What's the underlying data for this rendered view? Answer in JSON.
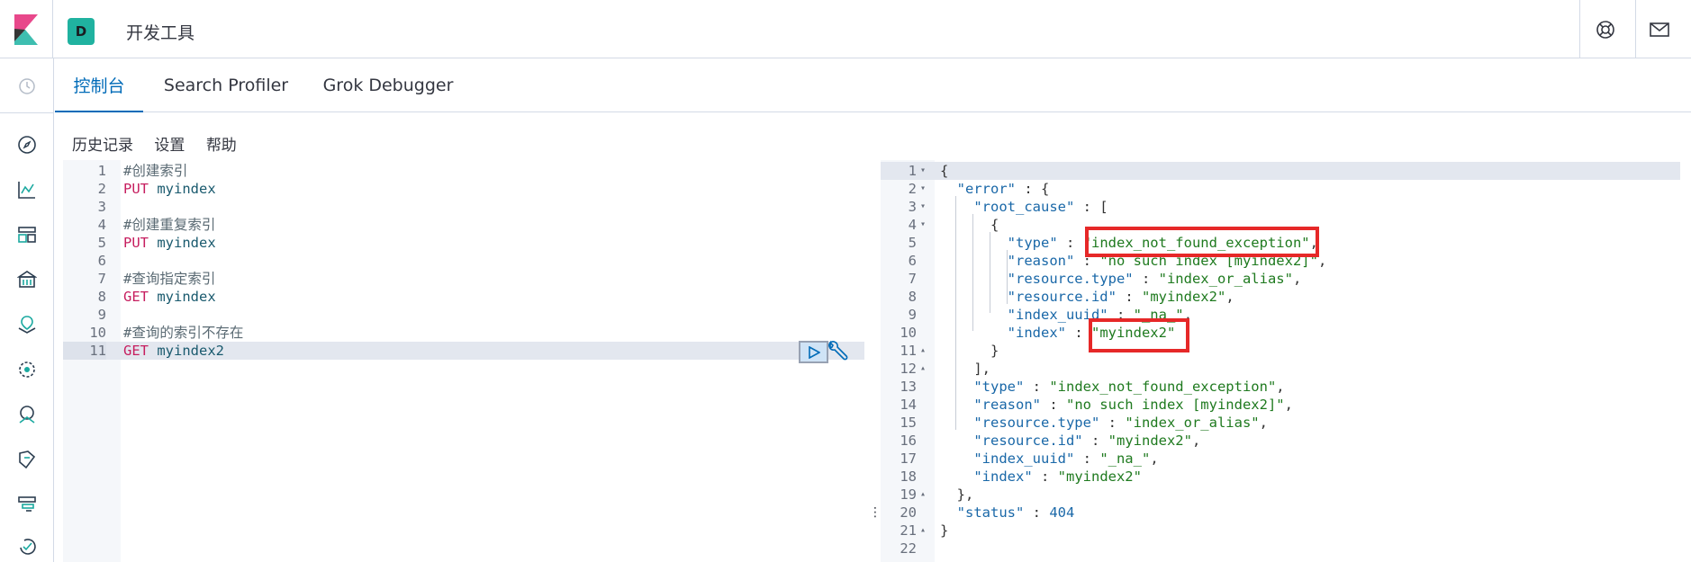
{
  "header": {
    "space_initial": "D",
    "title": "开发工具",
    "icons": [
      "help-lifebuoy-icon",
      "mail-icon"
    ]
  },
  "nav": {
    "icons": [
      "recent-clock-icon",
      "discover-compass-icon",
      "visualize-chart-icon",
      "dashboard-icon",
      "canvas-icon",
      "maps-icon",
      "ml-icon",
      "infrastructure-icon",
      "logs-icon",
      "apm-icon",
      "uptime-icon"
    ]
  },
  "tabs": [
    {
      "label": "控制台",
      "active": true
    },
    {
      "label": "Search Profiler",
      "active": false
    },
    {
      "label": "Grok Debugger",
      "active": false
    }
  ],
  "menu": {
    "history": "历史记录",
    "settings": "设置",
    "help": "帮助"
  },
  "request": {
    "lines": [
      {
        "n": "1",
        "type": "comment",
        "text": "#创建索引"
      },
      {
        "n": "2",
        "type": "req",
        "method": "PUT",
        "url": "myindex"
      },
      {
        "n": "3",
        "type": "blank",
        "text": ""
      },
      {
        "n": "4",
        "type": "comment",
        "text": "#创建重复索引"
      },
      {
        "n": "5",
        "type": "req",
        "method": "PUT",
        "url": "myindex"
      },
      {
        "n": "6",
        "type": "blank",
        "text": ""
      },
      {
        "n": "7",
        "type": "comment",
        "text": "#查询指定索引"
      },
      {
        "n": "8",
        "type": "req",
        "method": "GET",
        "url": "myindex"
      },
      {
        "n": "9",
        "type": "blank",
        "text": ""
      },
      {
        "n": "10",
        "type": "comment",
        "text": "#查询的索引不存在"
      },
      {
        "n": "11",
        "type": "req",
        "method": "GET",
        "url": "myindex2",
        "active": true
      }
    ]
  },
  "response": {
    "lines": [
      {
        "n": "1",
        "fold": "▾",
        "tokens": [
          [
            "pun",
            "{"
          ]
        ]
      },
      {
        "n": "2",
        "fold": "▾",
        "tokens": [
          [
            "pun",
            "  "
          ],
          [
            "key",
            "\"error\""
          ],
          [
            "pun",
            " : {"
          ]
        ]
      },
      {
        "n": "3",
        "fold": "▾",
        "tokens": [
          [
            "pun",
            "    "
          ],
          [
            "key",
            "\"root_cause\""
          ],
          [
            "pun",
            " : ["
          ]
        ]
      },
      {
        "n": "4",
        "fold": "▾",
        "tokens": [
          [
            "pun",
            "      {"
          ]
        ]
      },
      {
        "n": "5",
        "fold": "",
        "tokens": [
          [
            "pun",
            "        "
          ],
          [
            "key",
            "\"type\""
          ],
          [
            "pun",
            " : "
          ],
          [
            "str",
            "\"index_not_found_exception\""
          ],
          [
            "pun",
            ","
          ]
        ]
      },
      {
        "n": "6",
        "fold": "",
        "tokens": [
          [
            "pun",
            "        "
          ],
          [
            "key",
            "\"reason\""
          ],
          [
            "pun",
            " : "
          ],
          [
            "str",
            "\"no such index [myindex2]\""
          ],
          [
            "pun",
            ","
          ]
        ]
      },
      {
        "n": "7",
        "fold": "",
        "tokens": [
          [
            "pun",
            "        "
          ],
          [
            "key",
            "\"resource.type\""
          ],
          [
            "pun",
            " : "
          ],
          [
            "str",
            "\"index_or_alias\""
          ],
          [
            "pun",
            ","
          ]
        ]
      },
      {
        "n": "8",
        "fold": "",
        "tokens": [
          [
            "pun",
            "        "
          ],
          [
            "key",
            "\"resource.id\""
          ],
          [
            "pun",
            " : "
          ],
          [
            "str",
            "\"myindex2\""
          ],
          [
            "pun",
            ","
          ]
        ]
      },
      {
        "n": "9",
        "fold": "",
        "tokens": [
          [
            "pun",
            "        "
          ],
          [
            "key",
            "\"index_uuid\""
          ],
          [
            "pun",
            " : "
          ],
          [
            "str",
            "\"_na_\""
          ],
          [
            "pun",
            ","
          ]
        ]
      },
      {
        "n": "10",
        "fold": "",
        "tokens": [
          [
            "pun",
            "        "
          ],
          [
            "key",
            "\"index\""
          ],
          [
            "pun",
            " : "
          ],
          [
            "str",
            "\"myindex2\""
          ]
        ]
      },
      {
        "n": "11",
        "fold": "▴",
        "tokens": [
          [
            "pun",
            "      }"
          ]
        ]
      },
      {
        "n": "12",
        "fold": "▴",
        "tokens": [
          [
            "pun",
            "    ],"
          ]
        ]
      },
      {
        "n": "13",
        "fold": "",
        "tokens": [
          [
            "pun",
            "    "
          ],
          [
            "key",
            "\"type\""
          ],
          [
            "pun",
            " : "
          ],
          [
            "str",
            "\"index_not_found_exception\""
          ],
          [
            "pun",
            ","
          ]
        ]
      },
      {
        "n": "14",
        "fold": "",
        "tokens": [
          [
            "pun",
            "    "
          ],
          [
            "key",
            "\"reason\""
          ],
          [
            "pun",
            " : "
          ],
          [
            "str",
            "\"no such index [myindex2]\""
          ],
          [
            "pun",
            ","
          ]
        ]
      },
      {
        "n": "15",
        "fold": "",
        "tokens": [
          [
            "pun",
            "    "
          ],
          [
            "key",
            "\"resource.type\""
          ],
          [
            "pun",
            " : "
          ],
          [
            "str",
            "\"index_or_alias\""
          ],
          [
            "pun",
            ","
          ]
        ]
      },
      {
        "n": "16",
        "fold": "",
        "tokens": [
          [
            "pun",
            "    "
          ],
          [
            "key",
            "\"resource.id\""
          ],
          [
            "pun",
            " : "
          ],
          [
            "str",
            "\"myindex2\""
          ],
          [
            "pun",
            ","
          ]
        ]
      },
      {
        "n": "17",
        "fold": "",
        "tokens": [
          [
            "pun",
            "    "
          ],
          [
            "key",
            "\"index_uuid\""
          ],
          [
            "pun",
            " : "
          ],
          [
            "str",
            "\"_na_\""
          ],
          [
            "pun",
            ","
          ]
        ]
      },
      {
        "n": "18",
        "fold": "",
        "tokens": [
          [
            "pun",
            "    "
          ],
          [
            "key",
            "\"index\""
          ],
          [
            "pun",
            " : "
          ],
          [
            "str",
            "\"myindex2\""
          ]
        ]
      },
      {
        "n": "19",
        "fold": "▴",
        "tokens": [
          [
            "pun",
            "  },"
          ]
        ]
      },
      {
        "n": "20",
        "fold": "",
        "tokens": [
          [
            "pun",
            "  "
          ],
          [
            "key",
            "\"status\""
          ],
          [
            "pun",
            " : "
          ],
          [
            "num",
            "404"
          ]
        ]
      },
      {
        "n": "21",
        "fold": "▴",
        "tokens": [
          [
            "pun",
            "}"
          ]
        ]
      },
      {
        "n": "22",
        "fold": "",
        "tokens": []
      }
    ]
  },
  "colors": {
    "accent": "#006bb8",
    "badge": "#20b2a0",
    "annotation": "#e62828"
  }
}
